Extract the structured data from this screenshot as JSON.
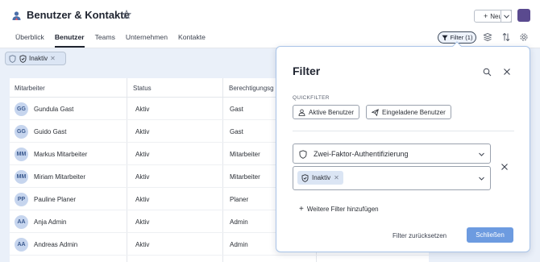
{
  "header": {
    "title": "Benutzer & Kontakte",
    "new_label": "Neu"
  },
  "tabs": [
    {
      "label": "Überblick"
    },
    {
      "label": "Benutzer"
    },
    {
      "label": "Teams"
    },
    {
      "label": "Unternehmen"
    },
    {
      "label": "Kontakte"
    }
  ],
  "toolbar": {
    "filter_label": "Filter (1)"
  },
  "active_chip": {
    "label": "Inaktiv"
  },
  "table": {
    "columns": [
      "Mitarbeiter",
      "Status",
      "Berechtigungsg"
    ],
    "rows": [
      {
        "initials": "GG",
        "name": "Gundula Gast",
        "status": "Aktiv",
        "role": "Gast"
      },
      {
        "initials": "GG",
        "name": "Guido Gast",
        "status": "Aktiv",
        "role": "Gast"
      },
      {
        "initials": "MM",
        "name": "Markus Mitarbeiter",
        "status": "Aktiv",
        "role": "Mitarbeiter"
      },
      {
        "initials": "MM",
        "name": "Miriam Mitarbeiter",
        "status": "Aktiv",
        "role": "Mitarbeiter"
      },
      {
        "initials": "PP",
        "name": "Pauline Planer",
        "status": "Aktiv",
        "role": "Planer"
      },
      {
        "initials": "AA",
        "name": "Anja Admin",
        "status": "Aktiv",
        "role": "Admin"
      },
      {
        "initials": "AA",
        "name": "Andreas Admin",
        "status": "Aktiv",
        "role": "Admin"
      }
    ]
  },
  "filter_panel": {
    "title": "Filter",
    "quickfilter_label": "QUICKFILTER",
    "quick_active": "Aktive Benutzer",
    "quick_invited": "Eingeladene Benutzer",
    "field_select": "Zwei-Faktor-Authentifizierung",
    "value_chip": "Inaktiv",
    "add_filter": "Weitere Filter hinzufügen",
    "reset": "Filter zurücksetzen",
    "close": "Schließen"
  },
  "colors": {
    "accent": "#6d9be0",
    "background": "#eaf0f9",
    "chip": "#dbe5f4"
  }
}
